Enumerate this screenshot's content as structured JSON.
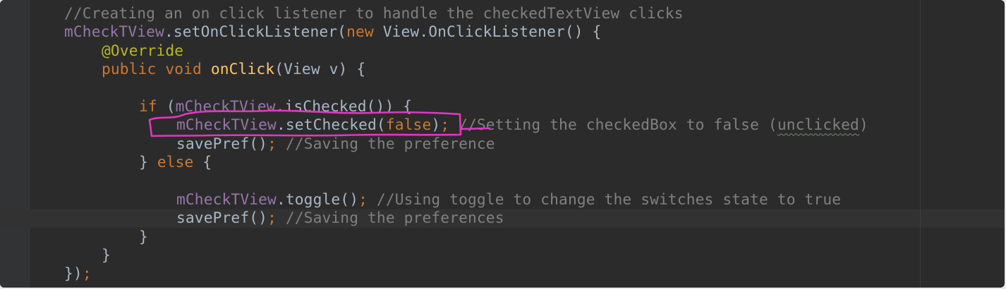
{
  "editor": {
    "lines": [
      {
        "tokens": [
          {
            "text": "//Creating an on click listener to handle the checkedTextView clicks",
            "kind": "comment"
          }
        ]
      },
      {
        "tokens": [
          {
            "text": "mCheckTView",
            "kind": "field"
          },
          {
            "text": ".setOnClickListener(",
            "kind": "plain"
          },
          {
            "text": "new ",
            "kind": "keyword"
          },
          {
            "text": "View.OnClickListener() {",
            "kind": "plain"
          }
        ]
      },
      {
        "indent": 1,
        "tokens": [
          {
            "text": "@Override",
            "kind": "annotation"
          }
        ]
      },
      {
        "indent": 1,
        "tokens": [
          {
            "text": "public void ",
            "kind": "keyword"
          },
          {
            "text": "onClick",
            "kind": "method"
          },
          {
            "text": "(View v) {",
            "kind": "plain"
          }
        ]
      },
      {
        "tokens": []
      },
      {
        "indent": 2,
        "tokens": [
          {
            "text": "if ",
            "kind": "keyword"
          },
          {
            "text": "(",
            "kind": "plain"
          },
          {
            "text": "mCheckTView",
            "kind": "field"
          },
          {
            "text": ".isChecked()) {",
            "kind": "plain"
          }
        ]
      },
      {
        "indent": 3,
        "tokens": [
          {
            "text": "mCheckTView",
            "kind": "field"
          },
          {
            "text": ".setChecked(",
            "kind": "plain"
          },
          {
            "text": "false",
            "kind": "keyword"
          },
          {
            "text": ")",
            "kind": "plain"
          },
          {
            "text": ";",
            "kind": "keyword"
          },
          {
            "text": " //Setting the checkedBox to false (",
            "kind": "comment"
          },
          {
            "text": "unclicked",
            "kind": "comment-typo"
          },
          {
            "text": ")",
            "kind": "comment"
          }
        ]
      },
      {
        "indent": 3,
        "tokens": [
          {
            "text": "savePref()",
            "kind": "plain"
          },
          {
            "text": ";",
            "kind": "keyword"
          },
          {
            "text": " //Saving the preference",
            "kind": "comment"
          }
        ]
      },
      {
        "indent": 2,
        "tokens": [
          {
            "text": "} ",
            "kind": "plain"
          },
          {
            "text": "else ",
            "kind": "keyword"
          },
          {
            "text": "{",
            "kind": "plain"
          }
        ]
      },
      {
        "tokens": []
      },
      {
        "indent": 3,
        "tokens": [
          {
            "text": "mCheckTView",
            "kind": "field"
          },
          {
            "text": ".toggle()",
            "kind": "plain"
          },
          {
            "text": ";",
            "kind": "keyword"
          },
          {
            "text": " //Using toggle to change the switches state to true",
            "kind": "comment"
          }
        ]
      },
      {
        "indent": 3,
        "tokens": [
          {
            "text": "savePref()",
            "kind": "plain"
          },
          {
            "text": ";",
            "kind": "keyword"
          },
          {
            "text": " //Saving the preferences",
            "kind": "comment"
          }
        ]
      },
      {
        "indent": 2,
        "tokens": [
          {
            "text": "}",
            "kind": "plain"
          }
        ]
      },
      {
        "indent": 1,
        "tokens": [
          {
            "text": "}",
            "kind": "plain"
          }
        ]
      },
      {
        "tokens": [
          {
            "text": "})",
            "kind": "plain"
          },
          {
            "text": ";",
            "kind": "keyword"
          }
        ]
      }
    ],
    "current_line_index": 11,
    "colors": {
      "background": "#2b2b2b",
      "comment": "#808080",
      "keyword": "#cc7832",
      "field": "#9876aa",
      "method": "#ffc66d",
      "annotation": "#bbb529",
      "plain": "#a9b7c6",
      "highlight_marker": "#e535c4"
    }
  }
}
